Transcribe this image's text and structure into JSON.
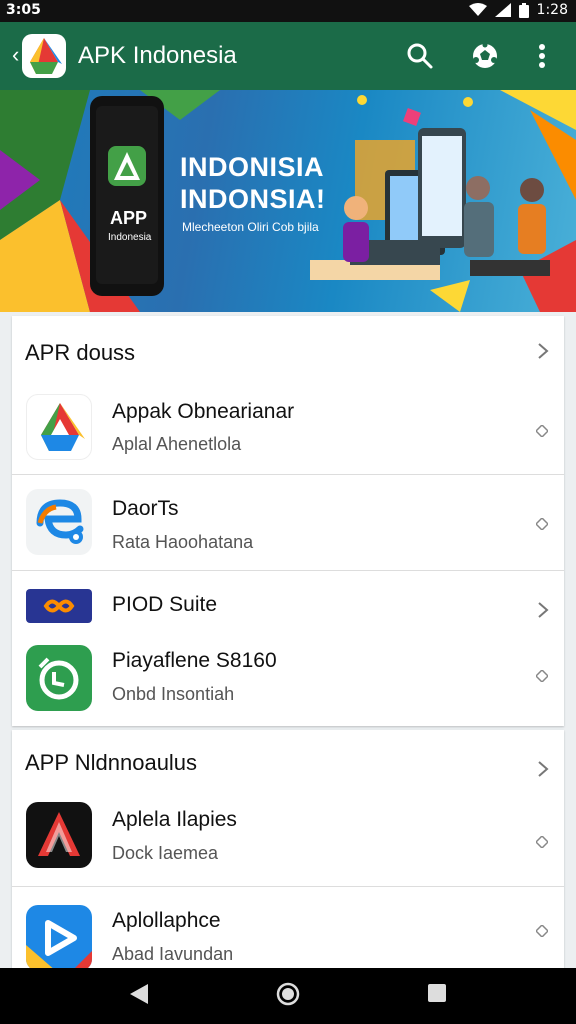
{
  "status_bar": {
    "time_left": "3:05",
    "time_right": "1:28"
  },
  "app_bar": {
    "back_icon": "back-arrow-icon",
    "title": "APK Indonesia",
    "actions": [
      "search-icon",
      "soccer-ball-icon",
      "more-vert-icon"
    ]
  },
  "banner": {
    "headline_1": "INDONISIA",
    "headline_2": "INDONSIA!",
    "subtitle": "Mlecheeton Oliri Cob bjila",
    "phone_label": "APP",
    "phone_sublabel": "Indonesia"
  },
  "sections": [
    {
      "title": "APR douss",
      "apps": [
        {
          "name": "Appak Obnearianar",
          "developer": "Aplal Ahenetlola",
          "icon": "drive-icon"
        },
        {
          "name": "DaorTs",
          "developer": "Rata Haoohatana",
          "icon": "edge-e-icon"
        },
        {
          "name": "PIOD Suite",
          "developer": "",
          "icon": "infinity-icon"
        },
        {
          "name": "Piayaflene S8160",
          "developer": "Onbd Insontiah",
          "icon": "timer-icon"
        }
      ]
    },
    {
      "title": "APP Nldnnoaulus",
      "apps": [
        {
          "name": "Aplela Ilapies",
          "developer": "Dock Iaemea",
          "icon": "triangle-a-icon"
        },
        {
          "name": "Aplollaphce",
          "developer": "Abad Iavundan",
          "icon": "play-arrow-icon"
        }
      ]
    }
  ],
  "nav_bar": [
    "back-triangle-icon",
    "home-circle-icon",
    "recents-square-icon"
  ],
  "colors": {
    "app_bar": "#1b6b48",
    "status_bar": "#111111",
    "nav_bar": "#000000",
    "card": "#ffffff"
  }
}
